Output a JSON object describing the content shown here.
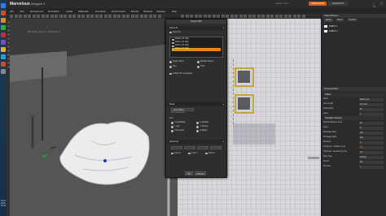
{
  "window": {
    "app_name": "Marvelous",
    "app_sub": "Designer 3",
    "version": "Version: 3.X.X",
    "controls": "‒ ▢ ✕",
    "simulation_label": "SIMULATION",
    "animation_label": "ANIMATION"
  },
  "menu": [
    "File",
    "Edit",
    "3D Garment",
    "2D Pattern",
    "Avatar",
    "Materials",
    "Animation",
    "Environment",
    "Render",
    "Window",
    "Settings",
    "Help"
  ],
  "taskbar": {
    "icon_colors": [
      "#2e7de0",
      "#d04a2a",
      "#e08a1e",
      "#3aa63a",
      "#c03030",
      "#7a4ec2",
      "#e0b030",
      "#2e9ad0",
      "#d04a2a",
      "#888888"
    ],
    "clock": "10:23",
    "date": "2013-04-10"
  },
  "viewport3d": {
    "info": "MD_Frame | Frame: 1 / 30  Objects: 3"
  },
  "viewport2d": {
    "info": "2D Pattern Window"
  },
  "dialog": {
    "title": "Export OBJ",
    "select_all": "Select All",
    "objects": [
      "Pattern_01 (obj)",
      "Pattern_02 (obj)",
      "Pattern_03 (obj)",
      "Pattern_04 (obj)"
    ],
    "selected_index": 3,
    "single_object": "Single Object",
    "multiple_objects": "Multiple Objects",
    "thin": "Thin",
    "thick": "Thick",
    "unified_uv": "Unified UV Coordinates",
    "scale_label": "Scale",
    "scale_combo": "Auto (Other)",
    "scale_sub": "Size of Garment",
    "axis_label": "Axis",
    "axis_options": [
      "X (Left/Right)",
      "X (Default)",
      "Y (Up)",
      "-Y (Down)",
      "Z (Forward)",
      "-Z (Back)"
    ],
    "advanced_label": "Advanced",
    "advanced_buttons": [
      "",
      "",
      "",
      ""
    ],
    "advanced_checks": [
      "Invert X",
      "Invert Y",
      "Invert Z"
    ],
    "ok_label": "OK",
    "cancel_label": "CANCEL"
  },
  "object_browser": {
    "title": "Object Browser",
    "tabs": [
      "Fabric",
      "Button",
      "Topstitch"
    ],
    "items": [
      "FABRIC 1",
      "FABRIC 2"
    ]
  },
  "property_editor": {
    "title": "Property Editor",
    "head1": "Pattern",
    "rows1": [
      {
        "label": "Name",
        "value": "Pattern_01"
      },
      {
        "label": "Line Length",
        "value": "14.3 mm"
      },
      {
        "label": "Particle Dist.",
        "value": "20"
      },
      {
        "label": "Layer",
        "value": "0"
      }
    ],
    "head2": "Simulation Property",
    "rows2": [
      {
        "label": "Particle Distance (mm)",
        "value": "20"
      },
      {
        "label": "Layer",
        "value": "0"
      },
      {
        "label": "Shrinkage Weft",
        "value": "100"
      },
      {
        "label": "Shrinkage Warp",
        "value": "100"
      },
      {
        "label": "Pressure",
        "value": "0"
      },
      {
        "label": "Thickness - Collision (mm)",
        "value": "2.5",
        "orange": true
      },
      {
        "label": "Thickness - Rendering (mm)",
        "value": "1.0"
      },
      {
        "label": "Edge Type",
        "value": "Normal"
      },
      {
        "label": "Freeze",
        "value": "Off"
      },
      {
        "label": "Pressure",
        "value": "0",
        "orange": true
      }
    ]
  }
}
